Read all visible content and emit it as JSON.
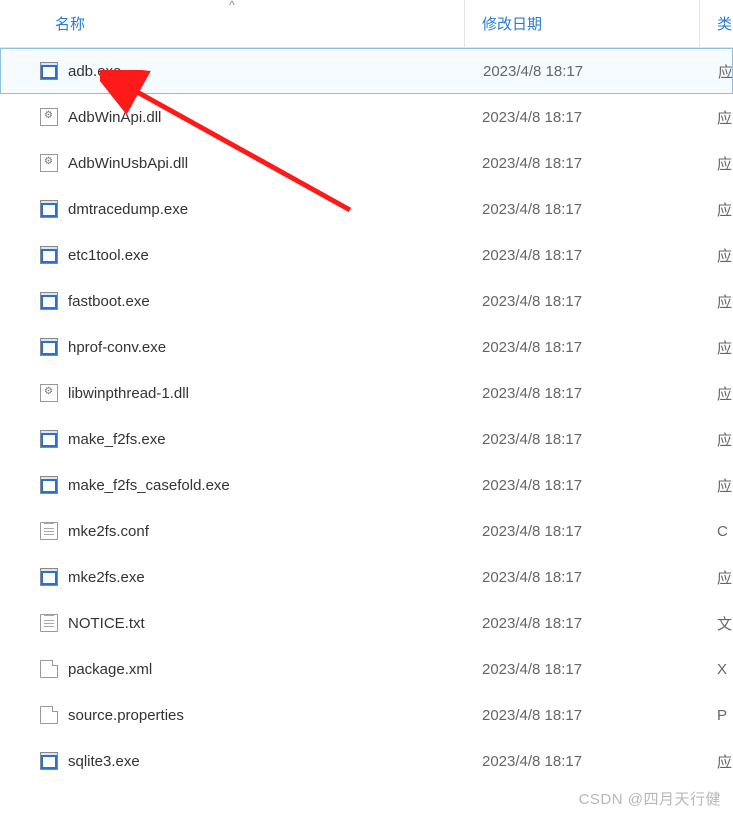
{
  "header": {
    "name": "名称",
    "date": "修改日期",
    "type": "类",
    "sort_arrow": "^"
  },
  "files": [
    {
      "name": "adb.exe",
      "date": "2023/4/8 18:17",
      "type": "应",
      "icon": "exe",
      "selected": true
    },
    {
      "name": "AdbWinApi.dll",
      "date": "2023/4/8 18:17",
      "type": "应",
      "icon": "dll",
      "selected": false
    },
    {
      "name": "AdbWinUsbApi.dll",
      "date": "2023/4/8 18:17",
      "type": "应",
      "icon": "dll",
      "selected": false
    },
    {
      "name": "dmtracedump.exe",
      "date": "2023/4/8 18:17",
      "type": "应",
      "icon": "exe",
      "selected": false
    },
    {
      "name": "etc1tool.exe",
      "date": "2023/4/8 18:17",
      "type": "应",
      "icon": "exe",
      "selected": false
    },
    {
      "name": "fastboot.exe",
      "date": "2023/4/8 18:17",
      "type": "应",
      "icon": "exe",
      "selected": false
    },
    {
      "name": "hprof-conv.exe",
      "date": "2023/4/8 18:17",
      "type": "应",
      "icon": "exe",
      "selected": false
    },
    {
      "name": "libwinpthread-1.dll",
      "date": "2023/4/8 18:17",
      "type": "应",
      "icon": "dll",
      "selected": false
    },
    {
      "name": "make_f2fs.exe",
      "date": "2023/4/8 18:17",
      "type": "应",
      "icon": "exe",
      "selected": false
    },
    {
      "name": "make_f2fs_casefold.exe",
      "date": "2023/4/8 18:17",
      "type": "应",
      "icon": "exe",
      "selected": false
    },
    {
      "name": "mke2fs.conf",
      "date": "2023/4/8 18:17",
      "type": "C",
      "icon": "txt",
      "selected": false
    },
    {
      "name": "mke2fs.exe",
      "date": "2023/4/8 18:17",
      "type": "应",
      "icon": "exe",
      "selected": false
    },
    {
      "name": "NOTICE.txt",
      "date": "2023/4/8 18:17",
      "type": "文",
      "icon": "txt",
      "selected": false
    },
    {
      "name": "package.xml",
      "date": "2023/4/8 18:17",
      "type": "X",
      "icon": "file",
      "selected": false
    },
    {
      "name": "source.properties",
      "date": "2023/4/8 18:17",
      "type": "P",
      "icon": "file",
      "selected": false
    },
    {
      "name": "sqlite3.exe",
      "date": "2023/4/8 18:17",
      "type": "应",
      "icon": "exe",
      "selected": false
    }
  ],
  "watermark": "CSDN @四月天行健"
}
